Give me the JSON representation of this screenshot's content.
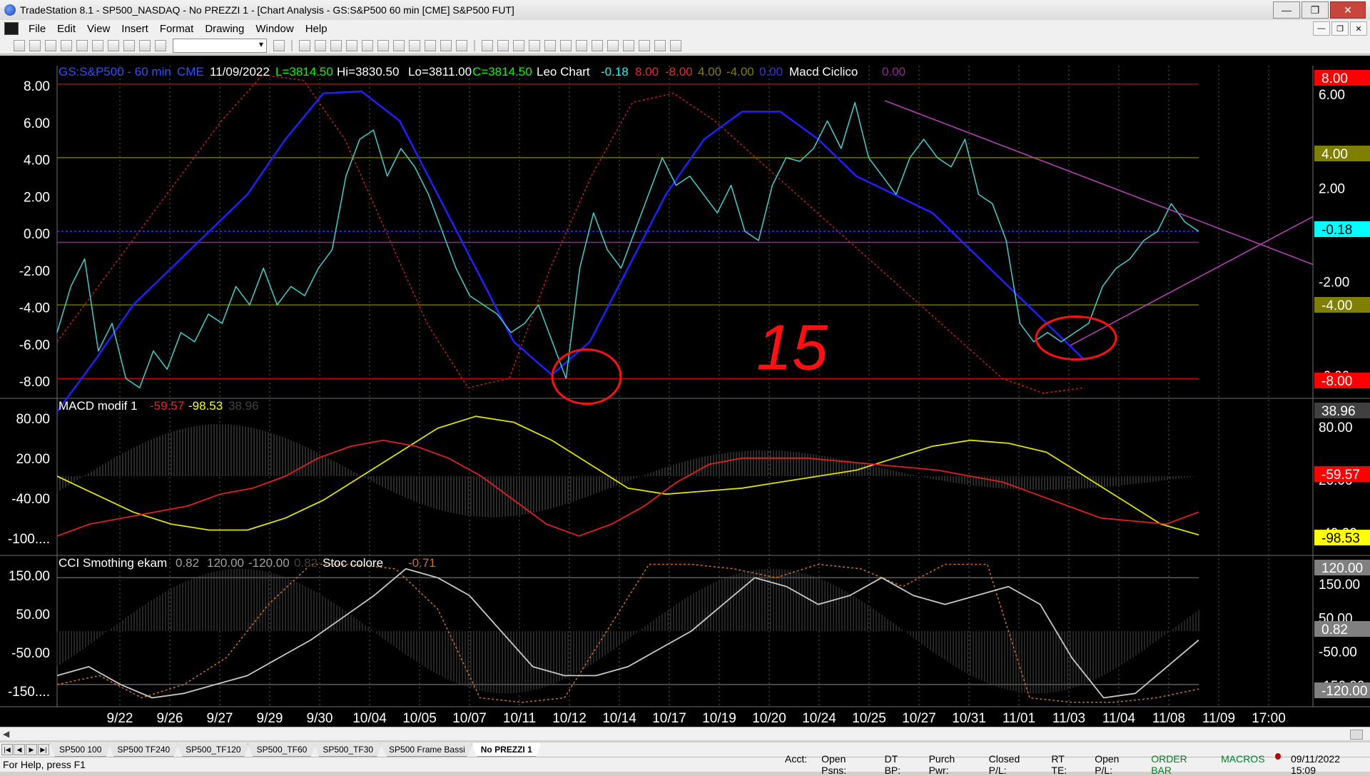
{
  "window": {
    "title": "TradeStation 8.1 - SP500_NASDAQ - No PREZZI 1 - [Chart Analysis - GS:S&P500  60 min  [CME] S&P500 FUT]"
  },
  "menu": [
    "File",
    "Edit",
    "View",
    "Insert",
    "Format",
    "Drawing",
    "Window",
    "Help"
  ],
  "chart": {
    "header": {
      "symbol": "GS:S&P500 - 60 min",
      "exchange": "CME",
      "date": "11/09/2022",
      "last": "L=3814.50",
      "hi": "Hi=3830.50",
      "lo": "Lo=3811.00",
      "close": "C=3814.50",
      "indicator1": "Leo Chart",
      "v1": "-0.18",
      "v2": "8.00",
      "v3": "-8.00",
      "v4": "4.00",
      "v5": "-4.00",
      "v6": "0.00",
      "indicator2": "Macd Ciclico",
      "v7": "0.00"
    },
    "pane1": {
      "y_ticks": [
        "8.00",
        "6.00",
        "4.00",
        "2.00",
        "0.00",
        "-2.00",
        "-4.00",
        "-6.00",
        "-8.00"
      ],
      "right_ticks": [
        "6.00",
        "2.00",
        "-2.00",
        "-6.00"
      ],
      "badges": [
        {
          "text": "8.00",
          "color": "#ff0000"
        },
        {
          "text": "4.00",
          "color": "#808000"
        },
        {
          "text": "-0.18",
          "color": "#00ffff"
        },
        {
          "text": "-4.00",
          "color": "#808000"
        },
        {
          "text": "-8.00",
          "color": "#ff0000"
        }
      ],
      "handwritten": "15"
    },
    "pane2": {
      "label": "MACD modif 1",
      "v1": "-59.57",
      "v2": "-98.53",
      "v3": "38.96",
      "y_ticks": [
        "80.00",
        "20.00",
        "-40.00",
        "-100...."
      ],
      "right_ticks": [
        "80.00",
        "20.00",
        "-40.00"
      ],
      "badges": [
        {
          "text": "38.96",
          "color": "#404040"
        },
        {
          "text": "-59.57",
          "color": "#ff0000"
        },
        {
          "text": "-98.53",
          "color": "#ffff00"
        }
      ]
    },
    "pane3": {
      "label": "CCI Smothing ekam",
      "v1": "0.82",
      "v2": "120.00",
      "v3": "-120.00",
      "v4": "0.82",
      "label2": "Stoc colore",
      "v5": "-0.71",
      "y_ticks": [
        "150.00",
        "50.00",
        "-50.00",
        "-150...."
      ],
      "right_ticks": [
        "150.00",
        "50.00",
        "-50.00",
        "-150.00"
      ],
      "badges": [
        {
          "text": "120.00",
          "color": "#808080"
        },
        {
          "text": "0.82",
          "color": "#808080"
        },
        {
          "text": "-120.00",
          "color": "#808080"
        }
      ]
    },
    "x_labels": [
      "9/22",
      "9/26",
      "9/27",
      "9/29",
      "9/30",
      "10/04",
      "10/05",
      "10/07",
      "10/11",
      "10/12",
      "10/14",
      "10/17",
      "10/19",
      "10/20",
      "10/24",
      "10/25",
      "10/27",
      "10/31",
      "11/01",
      "11/03",
      "11/04",
      "11/08",
      "11/09",
      "17:00"
    ]
  },
  "tabs": [
    "SP500 100",
    "SP500 TF240",
    "SP500_TF120",
    "SP500_TF60",
    "SP500_TF30",
    "SP500 Frame Bassi",
    "No PREZZI 1"
  ],
  "status": {
    "help": "For Help, press F1",
    "acct": "Acct:",
    "open_psns": "Open Psns:",
    "dt_bp": "DT BP:",
    "purch_pwr": "Purch Pwr:",
    "closed_pl": "Closed P/L:",
    "rt_te": "RT TE:",
    "open_pl": "Open P/L:",
    "order_bar": "ORDER BAR",
    "macros": "MACROS",
    "datetime": "09/11/2022 15:09"
  },
  "colors": {
    "price_line": "#40d0d0",
    "cycle_blue": "#2020ff",
    "cycle_red_dotted": "#c02020",
    "trendline": "#c040c0",
    "macd_red": "#e02020",
    "macd_yellow": "#e0e000",
    "cci_white": "#c8c8c8",
    "stoc_orange": "#d07020",
    "annotation_red": "#ff1010"
  },
  "chart_data": [
    {
      "type": "line",
      "name": "Leo Chart",
      "ylim": [
        -9,
        9
      ],
      "reference_lines": [
        8,
        4,
        0,
        -0.6,
        -4,
        -8
      ],
      "series": [
        {
          "name": "Leo Chart",
          "values": [
            -5.5,
            -3,
            -1.5,
            -6.5,
            -5,
            -8,
            -8.5,
            -6.5,
            -7.5,
            -5.5,
            -6,
            -4.5,
            -5,
            -3,
            -4,
            -2,
            -4,
            -3,
            -3.5,
            -2,
            -1,
            3,
            5,
            5.5,
            3,
            4.5,
            3.5,
            2,
            0,
            -2,
            -3.5,
            -4,
            -4.5,
            -5.5,
            -5,
            -4,
            -6,
            -8,
            -2,
            1,
            -1,
            -2,
            0,
            2,
            4,
            2.5,
            3,
            2,
            1,
            2.5,
            0,
            -0.5,
            2.5,
            4,
            3.8,
            4.5,
            6,
            4.5,
            7,
            4,
            3,
            2,
            4,
            5,
            4,
            3.5,
            5,
            2,
            1.5,
            -0.5,
            -5,
            -6,
            -5.5,
            -6,
            -5.5,
            -5,
            -3,
            -2,
            -1.5,
            -0.5,
            0,
            1.5,
            0.5,
            0
          ]
        },
        {
          "name": "cycle blue",
          "values": [
            -9.8,
            -7,
            -4,
            -2,
            0,
            2,
            5,
            7.5,
            7.6,
            6,
            2,
            -2,
            -6,
            -7.8,
            -6,
            -2,
            2,
            5,
            6.5,
            6.5,
            5,
            3,
            2,
            1,
            -1,
            -3,
            -5,
            -7
          ]
        },
        {
          "name": "cycle red dotted",
          "values": [
            -6,
            -3,
            0,
            3,
            6,
            8.5,
            8.2,
            5,
            0,
            -5,
            -8.5,
            -8,
            -2,
            3,
            7,
            7.5,
            6,
            4,
            2,
            0,
            -2,
            -4,
            -6,
            -8,
            -8.8,
            -8.5
          ]
        }
      ]
    },
    {
      "type": "line",
      "name": "MACD modif 1",
      "ylim": [
        -130,
        130
      ],
      "series": [
        {
          "name": "red",
          "values": [
            -100,
            -80,
            -70,
            -60,
            -50,
            -30,
            -20,
            0,
            30,
            50,
            60,
            50,
            30,
            0,
            -40,
            -80,
            -100,
            -80,
            -50,
            -10,
            20,
            30,
            30,
            30,
            25,
            20,
            15,
            10,
            0,
            -10,
            -30,
            -50,
            -70,
            -75,
            -80,
            -60
          ]
        },
        {
          "name": "yellow",
          "values": [
            0,
            -30,
            -60,
            -80,
            -90,
            -90,
            -70,
            -40,
            0,
            40,
            80,
            100,
            90,
            60,
            20,
            -20,
            -30,
            -25,
            -20,
            -10,
            0,
            10,
            30,
            50,
            60,
            55,
            40,
            0,
            -40,
            -80,
            -98
          ]
        }
      ]
    },
    {
      "type": "line",
      "name": "CCI Smothing ekam",
      "ylim": [
        -170,
        170
      ],
      "reference_lines": [
        120,
        -120
      ],
      "series": [
        {
          "name": "CCI",
          "values": [
            -100,
            -80,
            -120,
            -150,
            -140,
            -120,
            -100,
            -60,
            -20,
            30,
            80,
            140,
            120,
            80,
            0,
            -80,
            -100,
            -100,
            -80,
            -40,
            0,
            60,
            120,
            100,
            60,
            80,
            120,
            80,
            60,
            80,
            100,
            60,
            -60,
            -150,
            -140,
            -80,
            -20
          ]
        },
        {
          "name": "Stoc colore",
          "values": [
            -120,
            -100,
            -150,
            -120,
            -60,
            60,
            150,
            150,
            140,
            50,
            -150,
            -160,
            -150,
            0,
            150,
            150,
            140,
            120,
            150,
            140,
            100,
            150,
            150,
            -150,
            -160,
            -160,
            -150,
            -130
          ]
        }
      ]
    }
  ]
}
